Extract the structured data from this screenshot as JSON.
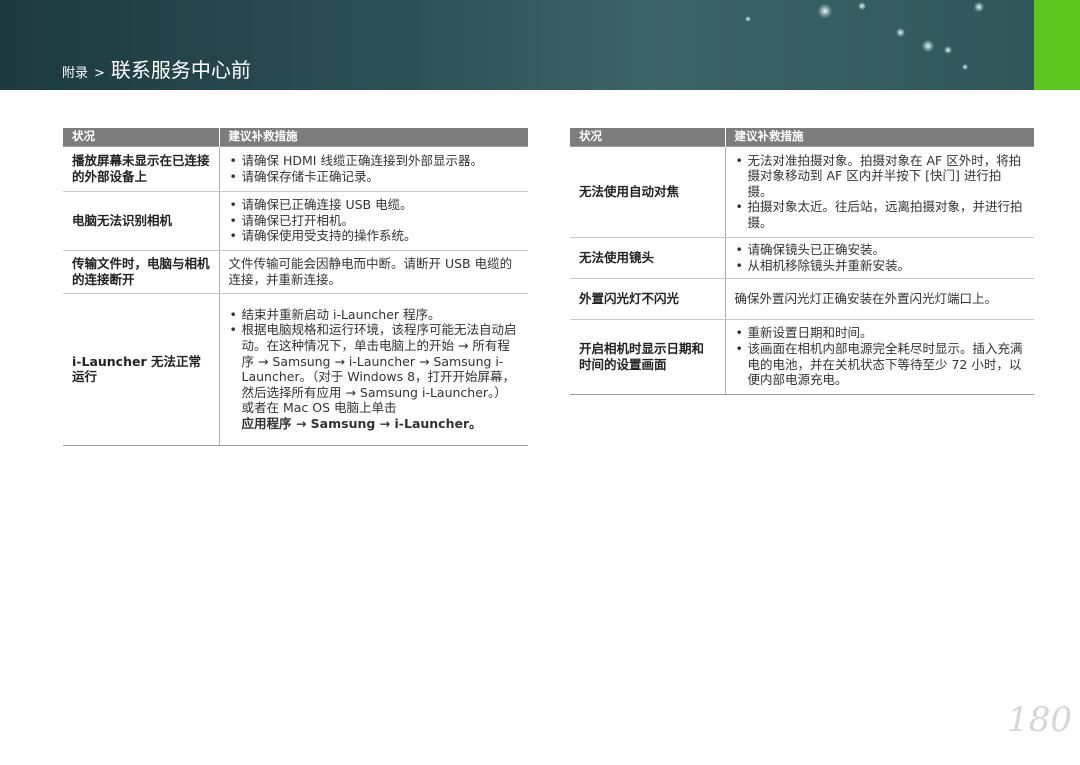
{
  "header": {
    "section": "附录",
    "separator": ">",
    "title": "联系服务中心前"
  },
  "left_table": {
    "col_condition": "状况",
    "col_solution": "建议补救措施",
    "rows": [
      {
        "condition": "播放屏幕未显示在已连接的外部设备上",
        "bullets": [
          "请确保 HDMI 线缆正确连接到外部显示器。",
          "请确保存储卡正确记录。"
        ]
      },
      {
        "condition": "电脑无法识别相机",
        "bullets": [
          "请确保已正确连接 USB 电缆。",
          "请确保已打开相机。",
          "请确保使用受支持的操作系统。"
        ]
      },
      {
        "condition": "传输文件时，电脑与相机的连接断开",
        "text": "文件传输可能会因静电而中断。请断开 USB 电缆的连接，并重新连接。"
      },
      {
        "condition": "i-Launcher 无法正常运行",
        "bullets": [
          "结束并重新启动 i-Launcher 程序。",
          "根据电脑规格和运行环境，该程序可能无法自动启动。在这种情况下，单击电脑上的开始 → 所有程序 → Samsung → i-Launcher → Samsung i-Launcher。（对于 Windows 8，打开开始屏幕，然后选择所有应用 → Samsung i-Launcher。）或者在 Mac OS 电脑上单击"
        ],
        "footer": "应用程序 → Samsung → i-Launcher。"
      }
    ]
  },
  "right_table": {
    "col_condition": "状况",
    "col_solution": "建议补救措施",
    "rows": [
      {
        "condition": "无法使用自动对焦",
        "bullets": [
          "无法对准拍摄对象。拍摄对象在 AF 区外时，将拍摄对象移动到 AF 区内并半按下 [快门] 进行拍摄。",
          "拍摄对象太近。往后站，远离拍摄对象，并进行拍摄。"
        ]
      },
      {
        "condition": "无法使用镜头",
        "bullets": [
          "请确保镜头已正确安装。",
          "从相机移除镜头并重新安装。"
        ]
      },
      {
        "condition": "外置闪光灯不闪光",
        "text": "确保外置闪光灯正确安装在外置闪光灯端口上。"
      },
      {
        "condition": "开启相机时显示日期和时间的设置画面",
        "bullets": [
          "重新设置日期和时间。",
          "该画面在相机内部电源完全耗尽时显示。插入充满电的电池，并在关机状态下等待至少 72 小时，以便内部电源充电。"
        ]
      }
    ]
  },
  "page_number": "180",
  "colors": {
    "banner": "#2c4e55",
    "accent_green": "#5ec71f",
    "table_header": "#7d7d7d"
  }
}
